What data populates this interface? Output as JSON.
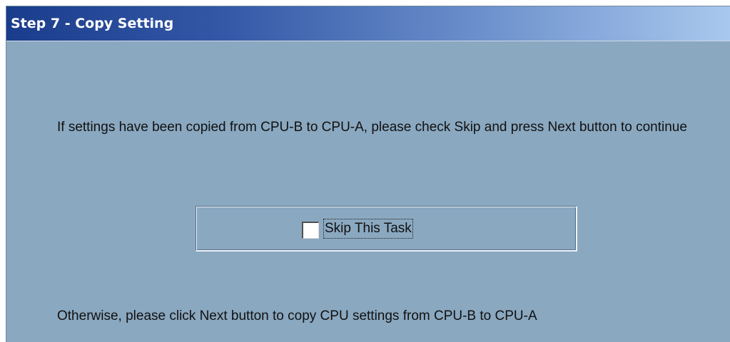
{
  "header": {
    "title": "Step 7 - Copy Setting"
  },
  "main": {
    "instruction": "If settings have been copied from CPU-B to CPU-A, please check Skip and press Next button to continue",
    "skip_checkbox": {
      "label": "Skip This Task",
      "checked": false
    },
    "otherwise_text": "Otherwise, please click Next button to copy CPU settings from CPU-B to CPU-A"
  },
  "colors": {
    "panel_background": "#8aa8c0",
    "title_gradient_start": "#1a3c8c",
    "title_gradient_end": "#a9c8ee",
    "title_text": "#ffffff"
  }
}
